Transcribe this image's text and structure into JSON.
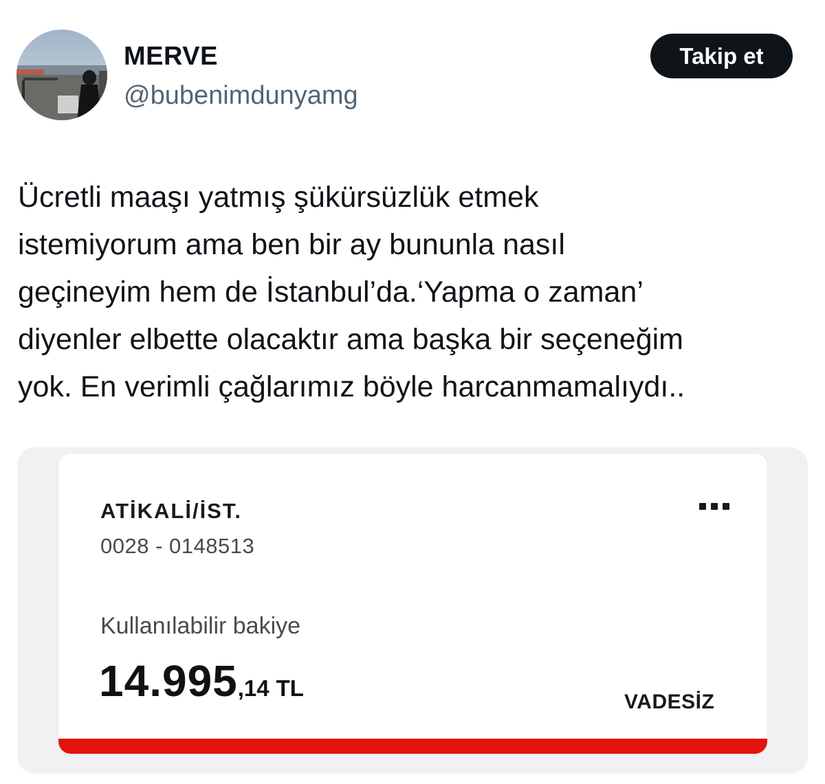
{
  "author": {
    "display_name": "MERVE",
    "handle": "@bubenimdunyamg",
    "avatar_icon": "profile-photo"
  },
  "actions": {
    "follow_label": "Takip et"
  },
  "tweet": {
    "lines": [
      "Ücretli maaşı yatmış şükürsüzlük etmek",
      "istemiyorum ama ben bir ay bununla nasıl",
      "geçineyim hem de İstanbul’da.‘Yapma o zaman’",
      "diyenler elbette olacaktır ama başka bir seçeneğim",
      "yok. En verimli çağlarımız böyle harcanmamalıydı.."
    ]
  },
  "media": {
    "account": {
      "branch": "ATİKALİ/İST.",
      "number": "0028 - 0148513",
      "menu_icon": "more-dots-icon",
      "balance_label": "Kullanılabilir bakiye",
      "balance_main": "14.995",
      "balance_decimals": ",14",
      "currency": "TL",
      "type": "VADESİZ"
    }
  },
  "colors": {
    "follow_button_bg": "#0f1419",
    "handle_text": "#536471",
    "card_accent": "#e3120b",
    "media_background": "#f1f1f3"
  }
}
